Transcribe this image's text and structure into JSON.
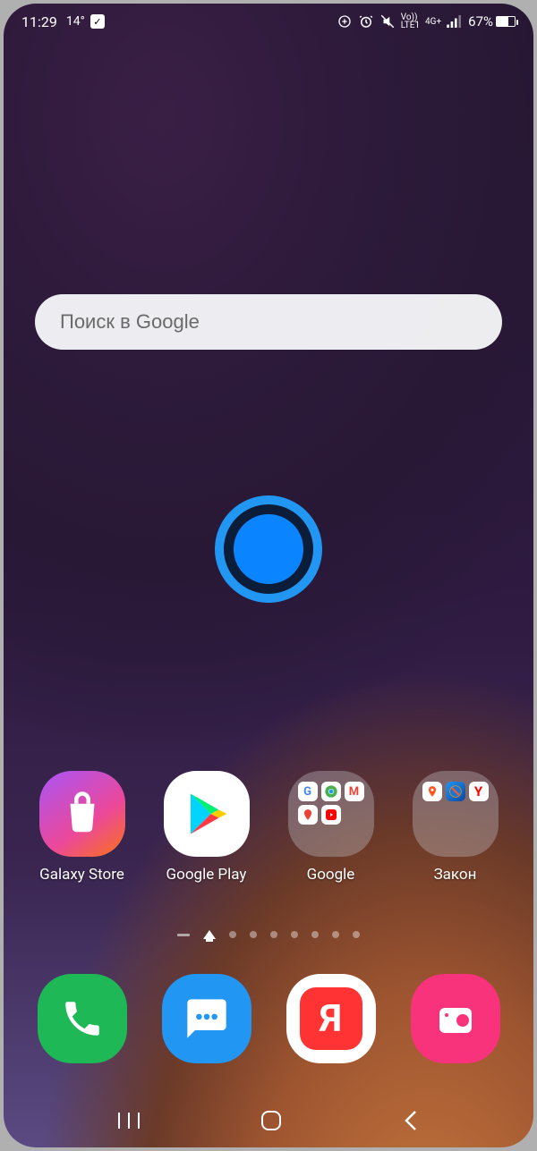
{
  "status": {
    "time": "11:29",
    "temperature": "14°",
    "lte_top": "Vo))",
    "lte_bottom": "LTE1",
    "network": "4G+",
    "battery_pct": "67%"
  },
  "search": {
    "placeholder": "Поиск в Google"
  },
  "apps": [
    {
      "label": "Galaxy Store"
    },
    {
      "label": "Google Play"
    },
    {
      "label": "Google"
    },
    {
      "label": "Закон"
    }
  ],
  "dock": {
    "yandex_letter": "Я"
  }
}
